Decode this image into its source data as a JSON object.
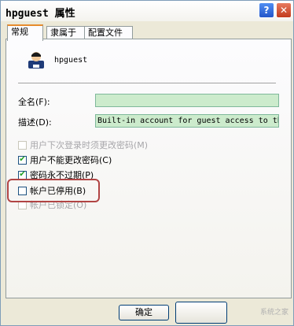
{
  "window": {
    "title": "hpguest 属性",
    "help_label": "?",
    "close_label": "✕"
  },
  "tabs": [
    {
      "label": "常规",
      "active": true
    },
    {
      "label": "隶属于"
    },
    {
      "label": "配置文件"
    }
  ],
  "user": {
    "name": "hpguest",
    "icon": "user-avatar-icon"
  },
  "fields": {
    "fullname_label": "全名(F):",
    "fullname_value": "",
    "description_label": "描述(D):",
    "description_value": "Built-in account for guest access to the"
  },
  "checkboxes": [
    {
      "label": "用户下次登录时须更改密码(M)",
      "checked": false,
      "disabled": true
    },
    {
      "label": "用户不能更改密码(C)",
      "checked": true,
      "disabled": false
    },
    {
      "label": "密码永不过期(P)",
      "checked": true,
      "disabled": false
    },
    {
      "label": "帐户已停用(B)",
      "checked": false,
      "disabled": false
    },
    {
      "label": "帐户已锁定(O)",
      "checked": false,
      "disabled": true
    }
  ],
  "buttons": {
    "ok_label": "确定"
  },
  "watermark": "系统之家"
}
